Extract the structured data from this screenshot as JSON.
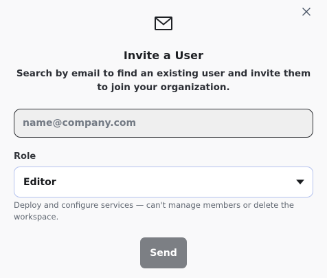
{
  "dialog": {
    "close_icon": "close-icon",
    "header_icon": "mail-icon",
    "title": "Invite a User",
    "subtitle": "Search by email to find an existing user and invite them to join your organization."
  },
  "email": {
    "placeholder": "name@company.com",
    "value": ""
  },
  "role": {
    "label": "Role",
    "selected": "Editor",
    "description": "Deploy and configure services — can't manage members or delete the workspace.",
    "icon": "chevron-down-icon"
  },
  "actions": {
    "send_label": "Send"
  },
  "colors": {
    "background": "#f9f9fa",
    "input_fill": "#efefef",
    "select_border": "#b4c2ee",
    "button_disabled": "#7c7f84"
  }
}
